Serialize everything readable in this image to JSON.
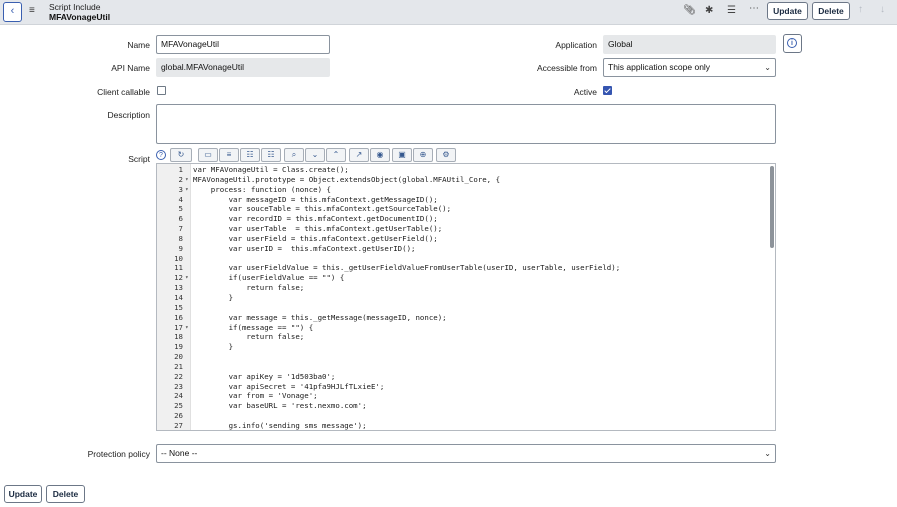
{
  "header": {
    "record_type": "Script Include",
    "record_name": "MFAVonageUtil",
    "update_label": "Update",
    "delete_label": "Delete",
    "icons": [
      "paperclip-icon",
      "activity-icon",
      "settings-sliders-icon",
      "more-icon",
      "arrow-up-icon",
      "arrow-down-icon"
    ]
  },
  "form": {
    "name_label": "Name",
    "name_value": "MFAVonageUtil",
    "api_name_label": "API Name",
    "api_name_value": "global.MFAVonageUtil",
    "client_callable_label": "Client callable",
    "client_callable": false,
    "application_label": "Application",
    "application_value": "Global",
    "accessible_from_label": "Accessible from",
    "accessible_from_value": "This application scope only",
    "active_label": "Active",
    "active": true,
    "description_label": "Description",
    "description_value": "",
    "script_label": "Script",
    "protection_policy_label": "Protection policy",
    "protection_policy_value": "-- None --"
  },
  "toolbar_icons": [
    "format-icon",
    "comment-icon",
    "uncomment-icon",
    "insert-icon",
    "script-fields-icon",
    "search-icon",
    "expand-icon",
    "collapse-icon",
    "fullscreen-icon",
    "help-icon",
    "save-icon",
    "script-search-icon",
    "debug-icon"
  ],
  "script_lines": [
    {
      "n": "1",
      "fold": false,
      "code": "var MFAVonageUtil = Class.create();"
    },
    {
      "n": "2",
      "fold": true,
      "code": "MFAVonageUtil.prototype = Object.extendsObject(global.MFAUtil_Core, {"
    },
    {
      "n": "3",
      "fold": true,
      "code": "    process: function (nonce) {"
    },
    {
      "n": "4",
      "fold": false,
      "code": "        var messageID = this.mfaContext.getMessageID();"
    },
    {
      "n": "5",
      "fold": false,
      "code": "        var souceTable = this.mfaContext.getSourceTable();"
    },
    {
      "n": "6",
      "fold": false,
      "code": "        var recordID = this.mfaContext.getDocumentID();"
    },
    {
      "n": "7",
      "fold": false,
      "code": "        var userTable  = this.mfaContext.getUserTable();"
    },
    {
      "n": "8",
      "fold": false,
      "code": "        var userField = this.mfaContext.getUserField();"
    },
    {
      "n": "9",
      "fold": false,
      "code": "        var userID =  this.mfaContext.getUserID();"
    },
    {
      "n": "10",
      "fold": false,
      "code": ""
    },
    {
      "n": "11",
      "fold": false,
      "code": "        var userFieldValue = this._getUserFieldValueFromUserTable(userID, userTable, userField);"
    },
    {
      "n": "12",
      "fold": true,
      "code": "        if(userFieldValue == \"\") {"
    },
    {
      "n": "13",
      "fold": false,
      "code": "            return false;"
    },
    {
      "n": "14",
      "fold": false,
      "code": "        }"
    },
    {
      "n": "15",
      "fold": false,
      "code": ""
    },
    {
      "n": "16",
      "fold": false,
      "code": "        var message = this._getMessage(messageID, nonce);"
    },
    {
      "n": "17",
      "fold": true,
      "code": "        if(message == \"\") {"
    },
    {
      "n": "18",
      "fold": false,
      "code": "            return false;"
    },
    {
      "n": "19",
      "fold": false,
      "code": "        }"
    },
    {
      "n": "20",
      "fold": false,
      "code": ""
    },
    {
      "n": "21",
      "fold": false,
      "code": ""
    },
    {
      "n": "22",
      "fold": false,
      "code": "        var apiKey = '1d503ba0';"
    },
    {
      "n": "23",
      "fold": false,
      "code": "        var apiSecret = '41pfa9HJLfTLxieE';"
    },
    {
      "n": "24",
      "fold": false,
      "code": "        var from = 'Vonage';"
    },
    {
      "n": "25",
      "fold": false,
      "code": "        var baseURL = 'rest.nexmo.com';"
    },
    {
      "n": "26",
      "fold": false,
      "code": ""
    },
    {
      "n": "27",
      "fold": false,
      "code": "        gs.info('sending sms message');"
    }
  ],
  "footer": {
    "update_label": "Update",
    "delete_label": "Delete"
  }
}
